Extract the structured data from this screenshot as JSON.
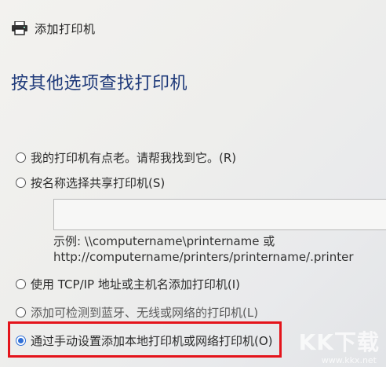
{
  "window": {
    "title": "添加打印机",
    "icon": "printer-icon"
  },
  "heading": "按其他选项查找打印机",
  "options": [
    {
      "label": "我的打印机有点老。请帮我找到它。(R)",
      "checked": false
    },
    {
      "label": "按名称选择共享打印机(S)",
      "checked": false
    },
    {
      "label": "使用 TCP/IP 地址或主机名添加打印机(I)",
      "checked": false
    },
    {
      "label": "添加可检测到蓝牙、无线或网络的打印机(L)",
      "checked": false
    },
    {
      "label": "通过手动设置添加本地打印机或网络打印机(O)",
      "checked": true
    }
  ],
  "share_name_input": {
    "value": ""
  },
  "example": {
    "line1": "示例: \\\\computername\\printername 或",
    "line2": "http://computername/printers/printername/.printer"
  },
  "colors": {
    "heading": "#1f3a7a",
    "highlight": "#e4141b",
    "radio_selected": "#2f6fd6"
  },
  "watermark": {
    "text": "KK下载",
    "url": "www.kkx.net"
  }
}
